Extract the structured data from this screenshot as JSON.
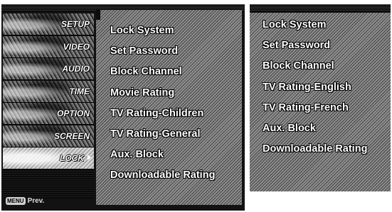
{
  "sidebar": {
    "items": [
      {
        "label": "SETUP"
      },
      {
        "label": "VIDEO"
      },
      {
        "label": "AUDIO"
      },
      {
        "label": "TIME"
      },
      {
        "label": "OPTION"
      },
      {
        "label": "SCREEN"
      },
      {
        "label": "LOCK",
        "active": true
      }
    ]
  },
  "footer": {
    "button_label": "MENU",
    "text": "Prev."
  },
  "left_menu": {
    "items": [
      "Lock System",
      "Set Password",
      "Block Channel",
      "Movie Rating",
      "TV Rating-Children",
      "TV Rating-General",
      "Aux. Block",
      "Downloadable Rating"
    ]
  },
  "right_menu": {
    "items": [
      "Lock System",
      "Set Password",
      "Block Channel",
      "TV Rating-English",
      "TV Rating-French",
      "Aux. Block",
      "Downloadable Rating"
    ]
  },
  "icons": {
    "active_item_arrow": "chevron-right-icon"
  },
  "colors": {
    "panel_bg": "#121212",
    "menu_area": "#8a8a8a",
    "text": "#ffffff"
  }
}
